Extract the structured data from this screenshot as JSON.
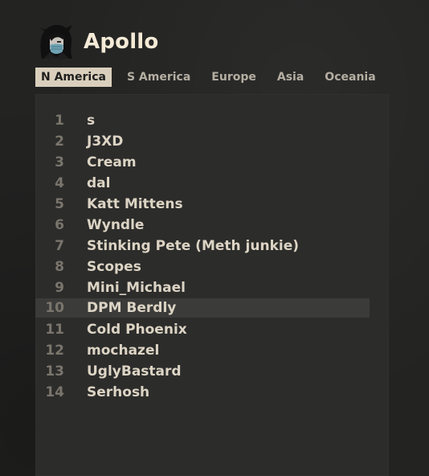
{
  "profile": {
    "name": "Apollo",
    "avatar_icon": "character-avatar-icon"
  },
  "regions": {
    "tabs": [
      "N America",
      "S America",
      "Europe",
      "Asia",
      "Oceania"
    ],
    "active": "N America"
  },
  "leaderboard": {
    "highlighted_rank": "10",
    "rows": [
      {
        "rank": "1",
        "name": "s"
      },
      {
        "rank": "2",
        "name": "J3XD"
      },
      {
        "rank": "3",
        "name": "Cream"
      },
      {
        "rank": "4",
        "name": "dal"
      },
      {
        "rank": "5",
        "name": "Katt Mittens"
      },
      {
        "rank": "6",
        "name": "Wyndle"
      },
      {
        "rank": "7",
        "name": "Stinking Pete (Meth junkie)"
      },
      {
        "rank": "8",
        "name": "Scopes"
      },
      {
        "rank": "9",
        "name": "Mini_Michael"
      },
      {
        "rank": "10",
        "name": "DPM Berdly"
      },
      {
        "rank": "11",
        "name": "Cold Phoenix"
      },
      {
        "rank": "12",
        "name": "mochazel"
      },
      {
        "rank": "13",
        "name": "UglyBastard"
      },
      {
        "rank": "14",
        "name": "Serhosh"
      }
    ]
  },
  "colors": {
    "background": "#232322",
    "panel": "#2c2c2b",
    "active_tab": "#d9cfbc",
    "title": "#f4ead6",
    "rank_text": "#7a756c",
    "name_text": "#dcd4c4",
    "highlight_row": "#3b3b3a"
  }
}
